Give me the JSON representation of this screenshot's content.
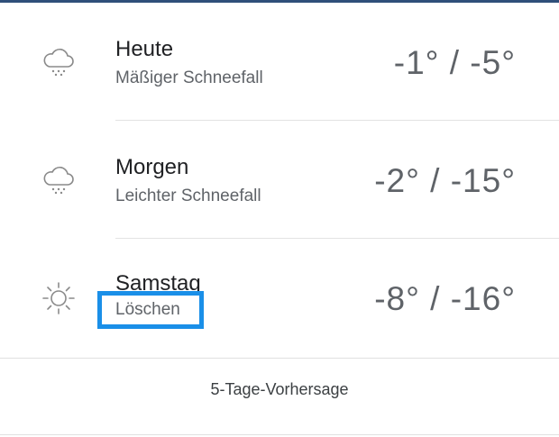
{
  "forecast": [
    {
      "day": "Heute",
      "condition": "Mäßiger Schneefall",
      "temps": "-1° / -5°",
      "icon": "snow-cloud-icon"
    },
    {
      "day": "Morgen",
      "condition": "Leichter Schneefall",
      "temps": "-2° / -15°",
      "icon": "snow-cloud-icon"
    },
    {
      "day": "Samstag",
      "condition": "Löschen",
      "temps": "-8° / -16°",
      "icon": "sun-icon"
    }
  ],
  "footer": {
    "link_label": "5-Tage-Vorhersage"
  },
  "colors": {
    "highlight": "#1a8fe8",
    "top_bar": "#2f4f7a"
  }
}
